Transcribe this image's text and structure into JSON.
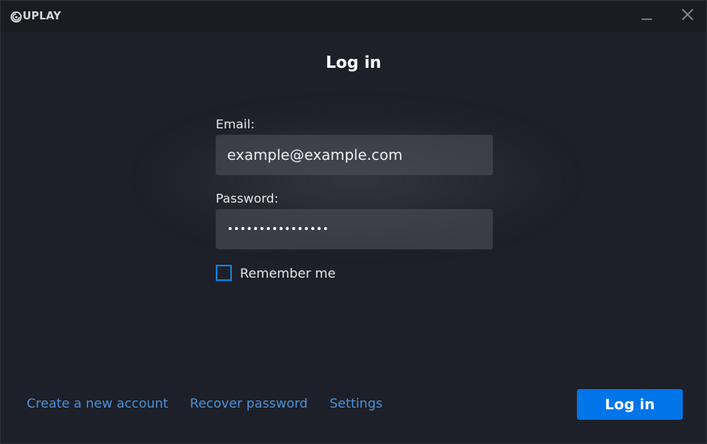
{
  "app": {
    "name": "UPLAY",
    "logo_icon": "ubisoft-swirl-icon"
  },
  "window_controls": {
    "minimize_icon": "minimize-icon",
    "close_icon": "close-icon"
  },
  "page": {
    "title": "Log in"
  },
  "form": {
    "email_label": "Email:",
    "email_value": "example@example.com",
    "password_label": "Password:",
    "password_masked": "••••••••••••••••",
    "password_length": 16,
    "remember_label": "Remember me",
    "remember_checked": false
  },
  "footer": {
    "links": [
      {
        "label": "Create a new account"
      },
      {
        "label": "Recover password"
      },
      {
        "label": "Settings"
      }
    ],
    "login_button": "Log in"
  },
  "colors": {
    "accent": "#0075ea",
    "link": "#4a90d9",
    "checkbox_border": "#0e82d8",
    "background": "#1d2028",
    "titlebar": "#191c21"
  }
}
